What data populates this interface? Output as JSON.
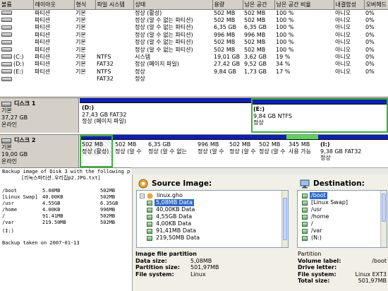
{
  "volume_table": {
    "headers": [
      "볼륨",
      "레이아웃",
      "형식",
      "파일 시스템",
      "상태",
      "용량",
      "남은 공간",
      "남은 공간 비율",
      "내결함성",
      "오버헤드"
    ],
    "rows": [
      [
        "",
        "파티션",
        "기본",
        "",
        "정상 (활성)",
        "502 MB",
        "502 MB",
        "100 %",
        "아니오",
        "0%"
      ],
      [
        "",
        "파티션",
        "기본",
        "",
        "정상 (알 수 없는 파티션)",
        "502 MB",
        "502 MB",
        "100 %",
        "아니오",
        "0%"
      ],
      [
        "",
        "파티션",
        "기본",
        "",
        "정상 (알 수 없는 파티션)",
        "6,35 GB",
        "6,35 GB",
        "100 %",
        "아니오",
        "0%"
      ],
      [
        "",
        "파티션",
        "기본",
        "",
        "정상 (알 수 없는 파티션)",
        "996 MB",
        "996 MB",
        "100 %",
        "아니오",
        "0%"
      ],
      [
        "",
        "파티션",
        "기본",
        "",
        "정상 (알 수 없는 파티션)",
        "502 MB",
        "502 MB",
        "100 %",
        "아니오",
        "0%"
      ],
      [
        "",
        "파티션",
        "기본",
        "",
        "정상 (알 수 없는 파티션)",
        "502 MB",
        "502 MB",
        "100 %",
        "아니오",
        "0%"
      ],
      [
        "(C:)",
        "파티션",
        "기본",
        "NTFS",
        "시스템",
        "19,01 GB",
        "3,62 GB",
        "19 %",
        "아니오",
        "0%"
      ],
      [
        "(D:)",
        "파티션",
        "기본",
        "FAT32",
        "정상 (페이지 파일)",
        "27,42 GB",
        "9,52 GB",
        "34 %",
        "아니오",
        "0%"
      ],
      [
        "(E:)",
        "파티션",
        "기본",
        "NTFS",
        "정상",
        "9,84 GB",
        "1,73 GB",
        "17 %",
        "아니오",
        "0%"
      ],
      [
        "",
        "",
        "",
        "FAT32",
        "정상",
        "",
        "",
        "",
        "",
        ""
      ]
    ]
  },
  "disk1": {
    "name": "디스크 1",
    "type": "기본",
    "size": "37,27 GB",
    "status": "온라인",
    "partitions": [
      {
        "label": "(D:)",
        "size": "27,43 GB FAT32",
        "status": "정상 (페이지 파일)"
      },
      {
        "label": "(E:)",
        "size": "9,84 GB NTFS",
        "status": "정상"
      }
    ]
  },
  "disk2": {
    "name": "디스크 2",
    "type": "기본",
    "size": "19,00 GB",
    "status": "온라인",
    "partitions": [
      {
        "label": "",
        "size": "502 MB",
        "status": "정상 (활성)"
      },
      {
        "label": "",
        "size": "502 MB",
        "status": "정상 (알 수"
      },
      {
        "label": "",
        "size": "6,35 GB",
        "status": "정상 (알 수 없는"
      },
      {
        "label": "",
        "size": "996 MB",
        "status": "정상 (알 수"
      },
      {
        "label": "",
        "size": "502 MB",
        "status": "정상 (알 수"
      },
      {
        "label": "",
        "size": "502 MB",
        "status": "정상 (알 수"
      },
      {
        "label": "",
        "size": "345 MB",
        "status": "사용 가능"
      },
      {
        "label": "(I:)",
        "size": "9,38 GB FAT32",
        "status": "정상"
      }
    ]
  },
  "backup_log": {
    "title_line1": "Backup image of Disk 3 with the following p",
    "title_line2": "[리눅스파티션.우리집p2.JPG.txt]",
    "rows": [
      [
        "/boot",
        "5.08MB",
        "502MB"
      ],
      [
        "[Linux Swap]",
        "40.00KB",
        "502MB"
      ],
      [
        "/usr",
        "4.55GB",
        "6.35GB"
      ],
      [
        "/home",
        "4.00KB",
        "996MB"
      ],
      [
        "/",
        "91.41MB",
        "502MB"
      ],
      [
        "/var",
        "219.50MB",
        "502MB"
      ]
    ],
    "last_row": "(I:)",
    "footer": "Backup taken on 2007-01-13"
  },
  "source_panel": {
    "heading": "Source Image:",
    "root": "linux.gho",
    "items": [
      "5,08MB Data",
      "40,00KB Data",
      "4,55GB Data",
      "4,00KB Data",
      "91,41MB Data",
      "219,50MB Data"
    ],
    "selected_index": 0
  },
  "destination_panel": {
    "heading": "Destination:",
    "items": [
      "/boot",
      "[Linux Swap]",
      "/usr",
      "/home",
      "/",
      "/var",
      "(N:)"
    ],
    "selected_index": 0
  },
  "source_info": {
    "title": "Image file partition",
    "rows": [
      {
        "key": "Data size:",
        "value": "5,08MB"
      },
      {
        "key": "Partition size:",
        "value": "501,97MB"
      },
      {
        "key": "File system:",
        "value": "Linux"
      }
    ]
  },
  "dest_info": {
    "title": "Partition",
    "rows": [
      {
        "key": "Volume label:",
        "value": "/boot"
      },
      {
        "key": "Drive letter:",
        "value": ""
      },
      {
        "key": "File system:",
        "value": "Linux EXT3"
      },
      {
        "key": "Total size:",
        "value": "501,97MB"
      }
    ]
  },
  "colors": {
    "primary_partition": "#0f1fb2",
    "selection": "#3bb13b",
    "unallocated": "#0d0d0d",
    "highlight": "#316ac5"
  },
  "icons": {
    "disk": "disk-drive-icon",
    "image": "ghost-image-icon",
    "destination": "computer-icon",
    "partition": "partition-icon"
  }
}
